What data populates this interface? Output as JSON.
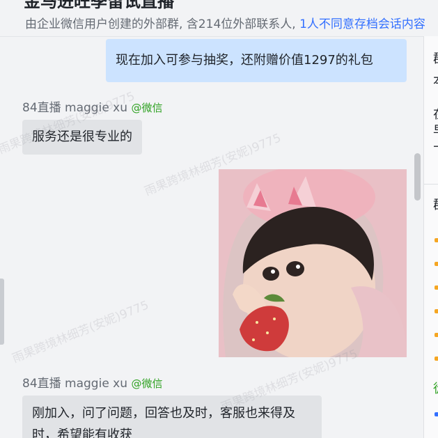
{
  "header": {
    "group_name": "金马进旺季留试直播",
    "subtitle_plain": "由企业微信用户创建的外部群, 含214位外部联系人, ",
    "subtitle_link": "1人不同意存档会话内容"
  },
  "messages": {
    "m1_text": "现在加入可参与抽奖，还附赠价值1297的礼包",
    "m2_sender": "84直播 maggie xu",
    "m2_source": "@微信",
    "m2_text": "服务还是很专业的",
    "m3_sender": "84直播 maggie xu",
    "m3_source": "@微信",
    "m3_text": "刚加入，问了问题，回答也及时，客服也来得及时，希望能有收获"
  },
  "watermark": "雨果跨境林细芳(安妮)9775",
  "right_panel": {
    "chars": [
      "群",
      "本",
      "在",
      "早",
      "十",
      "群",
      "徒"
    ]
  }
}
